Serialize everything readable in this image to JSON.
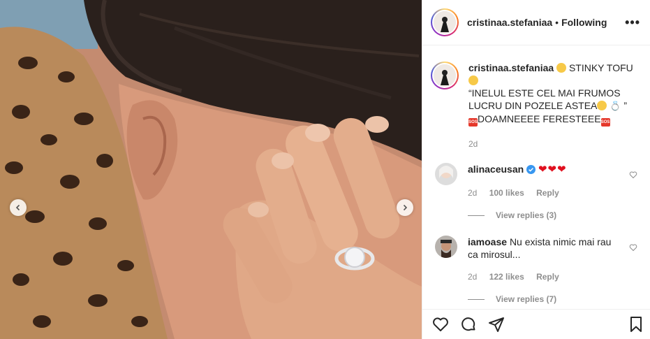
{
  "post": {
    "username": "cristinaa.stefaniaa",
    "separator": "•",
    "follow_status": "Following",
    "more_label": "•••"
  },
  "caption": {
    "username": "cristinaa.stefaniaa",
    "text_line1": "STINKY TOFU",
    "text_quote": "“INELUL ESTE CEL MAI FRUMOS LUCRU DIN POZELE ASTEA",
    "text_quote_end": " ”",
    "text_line3": "DOAMNEEEE FERESTEEE",
    "sos_label": "SOS",
    "time": "2d"
  },
  "comments": [
    {
      "username": "alinaceusan",
      "text": "",
      "hearts": "❤❤❤",
      "time": "2d",
      "likes": "100 likes",
      "reply": "Reply",
      "view_replies": "View replies (3)"
    },
    {
      "username": "iamoase",
      "text": "Nu exista nimic mai rau ca mirosul...",
      "time": "2d",
      "likes": "122 likes",
      "reply": "Reply",
      "view_replies": "View replies (7)"
    }
  ],
  "icons": {
    "like": "heart-icon",
    "comment": "comment-icon",
    "share": "share-icon",
    "save": "bookmark-icon",
    "prev": "chevron-left-icon",
    "next": "chevron-right-icon",
    "verified": "verified-badge-icon"
  },
  "colors": {
    "verified_blue": "#3897f0",
    "heart_red": "#e0101f",
    "border": "#efefef",
    "muted": "#8e8e8e"
  }
}
